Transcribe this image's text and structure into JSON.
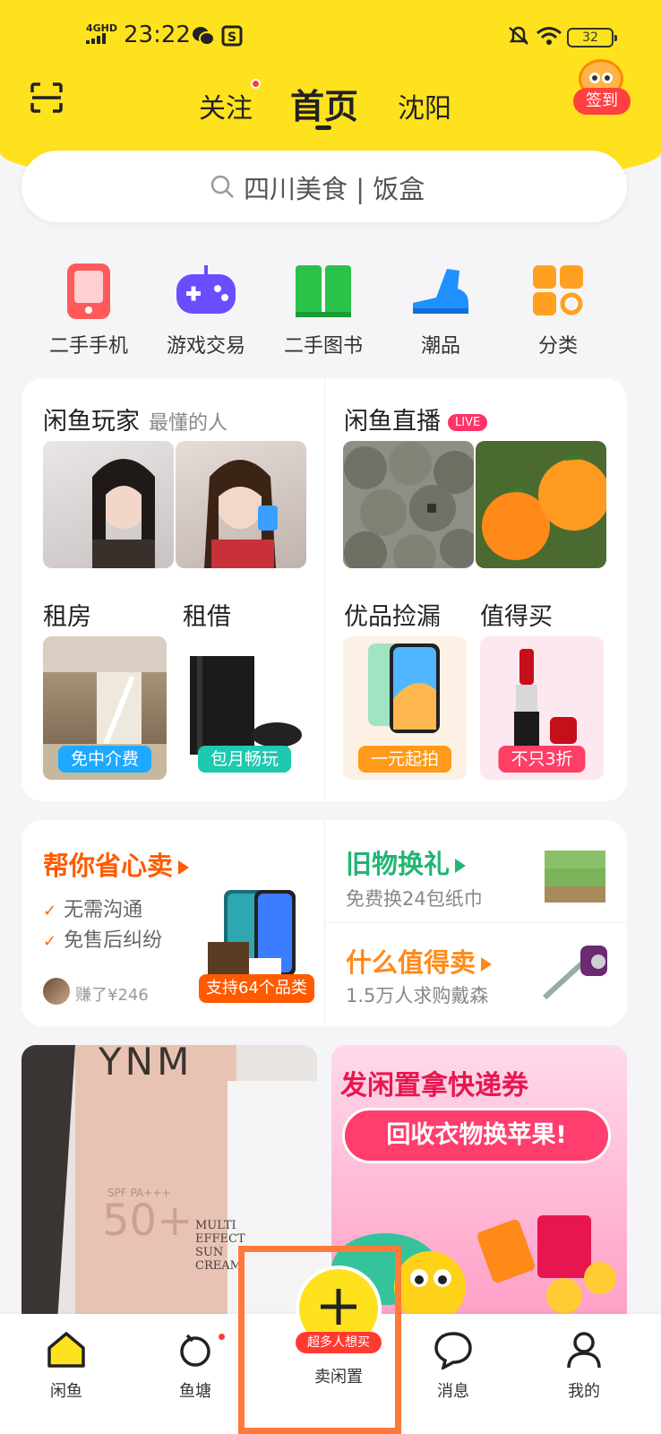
{
  "status_bar": {
    "network": "4GHD",
    "time": "23:22",
    "battery": "32"
  },
  "header": {
    "tabs": [
      {
        "label": "关注"
      },
      {
        "label": "首页"
      },
      {
        "label": "沈阳"
      }
    ],
    "signin_label": "签到"
  },
  "search": {
    "text": "四川美食 | 饭盒"
  },
  "categories": [
    {
      "label": "二手手机",
      "icon": "phone-icon"
    },
    {
      "label": "游戏交易",
      "icon": "gamepad-icon"
    },
    {
      "label": "二手图书",
      "icon": "book-icon"
    },
    {
      "label": "潮品",
      "icon": "sneaker-icon"
    },
    {
      "label": "分类",
      "icon": "grid-icon"
    }
  ],
  "feature_card": {
    "players": {
      "title": "闲鱼玩家",
      "subtitle": "最懂的人"
    },
    "live": {
      "title": "闲鱼直播",
      "badge": "LIVE"
    },
    "rent": {
      "title": "租房",
      "tag": "免中介费"
    },
    "lend": {
      "title": "租借",
      "tag": "包月畅玩"
    },
    "picks": {
      "title": "优品捡漏",
      "tag": "一元起拍"
    },
    "worth": {
      "title": "值得买",
      "tag": "不只3折"
    }
  },
  "sell_card": {
    "title": "帮你省心卖",
    "points": [
      "无需沟通",
      "免售后纠纷"
    ],
    "earned": "赚了¥246",
    "category_tag": "支持64个品类",
    "exchange_title": "旧物换礼",
    "exchange_sub": "免费换24包纸巾",
    "worth_title": "什么值得卖",
    "worth_sub": "1.5万人求购戴森"
  },
  "feed": {
    "item1": {
      "brand": "YNM",
      "spf": "SPF PA+++",
      "num": "50+",
      "product": [
        "MULTI",
        "EFFECT",
        "SUN",
        "CREAM"
      ]
    },
    "item2": {
      "line1": "发闲置拿快递券",
      "line2": "回收衣物换苹果!"
    }
  },
  "tabbar": {
    "items": [
      {
        "label": "闲鱼"
      },
      {
        "label": "鱼塘"
      },
      {
        "label": "卖闲置",
        "badge": "超多人想买"
      },
      {
        "label": "消息"
      },
      {
        "label": "我的"
      }
    ]
  },
  "colors": {
    "brand_yellow": "#ffe21e",
    "orange": "#ff5a00",
    "green": "#22b573"
  }
}
